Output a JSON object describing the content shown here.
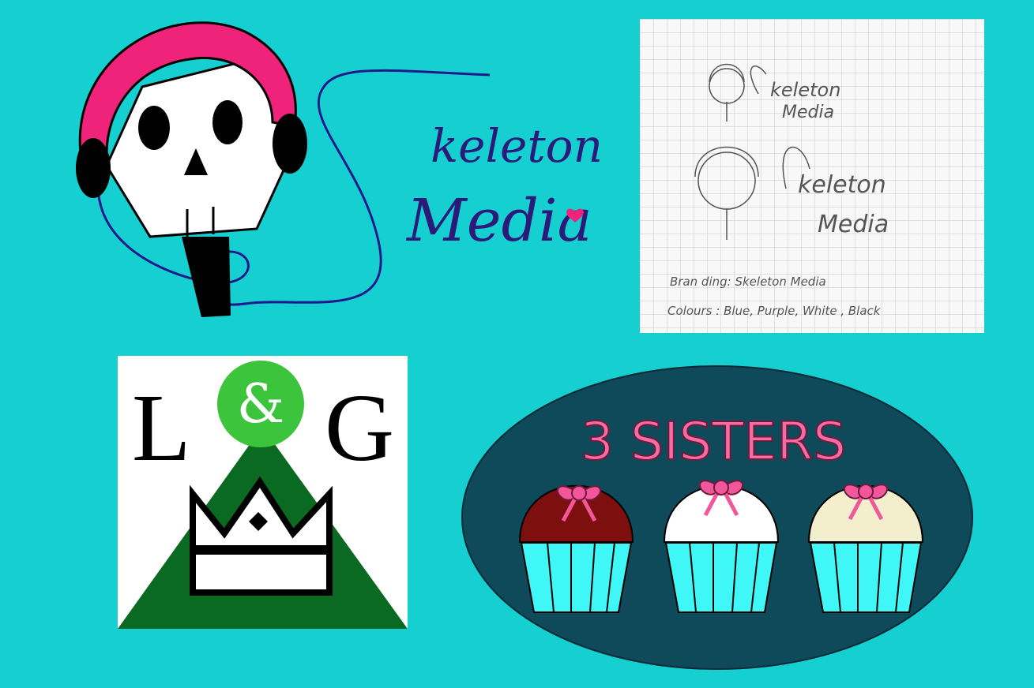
{
  "skeleton_logo": {
    "line1": "keleton",
    "line2": "Media",
    "colors": {
      "headphone_band": "#ef2379",
      "wordmark": "#2a1a7a",
      "cord": "#1e1a8a",
      "heart": "#ef2379",
      "skull": "#ffffff"
    }
  },
  "sketch": {
    "small_line1": "keleton",
    "small_line2": "Media",
    "large_line1": "keleton",
    "large_line2": "Media",
    "note_branding": "Bran ding: Skeleton Media",
    "note_colours": "Colours : Blue, Purple, White , Black"
  },
  "lg_logo": {
    "letter_left": "L",
    "ampersand": "&",
    "letter_right": "G",
    "colors": {
      "circle": "#3cc43c",
      "triangle": "#0b6a22",
      "crown": "#ffffff"
    }
  },
  "sisters_logo": {
    "title": "3 SISTERS",
    "colors": {
      "oval": "#0f4a5a",
      "title": "#f56ba3",
      "bow": "#f2569b",
      "liner": "#3ff7f7",
      "cupcake_tops": [
        "#7e0f0f",
        "#ffffff",
        "#f3efcd"
      ]
    }
  }
}
